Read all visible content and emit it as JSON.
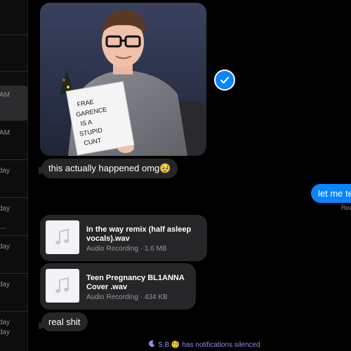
{
  "sidebar": {
    "items": [
      {
        "time": "AM"
      },
      {
        "time": "AM"
      },
      {
        "time": "day"
      },
      {
        "time": "day"
      },
      {
        "time": "day"
      },
      {
        "time": "day"
      },
      {
        "time": "day"
      },
      {
        "time": "day"
      }
    ],
    "truncated_preview": "..."
  },
  "photo": {
    "sign_text": "FRAE GARENCE IS A STUPID CUNT"
  },
  "messages": {
    "caption": "this actually happened omg🥹",
    "sent_text": "let me te",
    "receipt": "Rea",
    "final": "real shit"
  },
  "files": [
    {
      "name": "In the way remix (half asleep vocals).wav",
      "meta": "Audio Recording · 1.6 MB"
    },
    {
      "name": "Teen Pregnancy BL1ANNA Cover .wav",
      "meta": "Audio Recording · 434 KB"
    }
  ],
  "footer": {
    "silenced_name": "S.B.🧐",
    "silenced_text": "has notifications silenced"
  },
  "colors": {
    "accent": "#0a84ff",
    "bubble": "#262628",
    "silenced": "#8e8ef0"
  }
}
